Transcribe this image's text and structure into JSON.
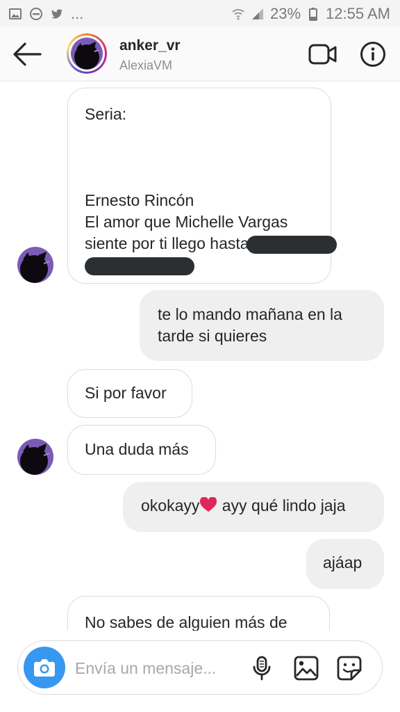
{
  "status_bar": {
    "dots": "...",
    "battery": "23%",
    "time": "12:55 AM"
  },
  "header": {
    "username": "anker_vr",
    "subtitle": "AlexiaVM"
  },
  "messages": {
    "m1_line1": "Seria:",
    "m1_line2": "Ernesto Rincón",
    "m1_line3": "El amor que Michelle Vargas",
    "m1_line4": "siente por ti llego hasta",
    "m2": "te lo mando mañana en la tarde si quieres",
    "m3": "Si por favor",
    "m4": "Una duda más",
    "m5_a": "okokayy",
    "m5_b": " ayy qué lindo jaja",
    "m6": "ajáap",
    "m7": "No sabes de alguien más de"
  },
  "composer": {
    "placeholder": "Envía un mensaje..."
  },
  "icons": {
    "back": "arrow-left",
    "video": "video-camera",
    "info": "info-circle",
    "camera": "camera",
    "mic": "microphone",
    "gallery": "image",
    "sticker": "sticker",
    "heart": "heart"
  },
  "colors": {
    "accent": "#3897f0",
    "heart": "#e0245e",
    "outgoing_bubble": "#efefef"
  }
}
